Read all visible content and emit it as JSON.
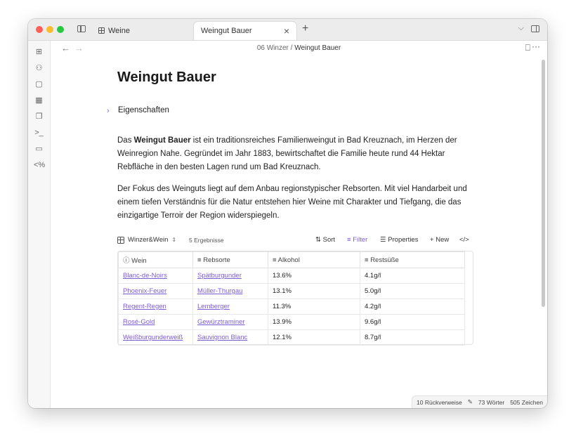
{
  "tabs": [
    {
      "label": "Weine",
      "active": false
    },
    {
      "label": "Weingut Bauer",
      "active": true
    }
  ],
  "breadcrumb": {
    "folder": "06 Winzer",
    "separator": "/",
    "current": "Weingut Bauer"
  },
  "page": {
    "title": "Weingut Bauer",
    "properties_label": "Eigenschaften",
    "para1_pre": "Das ",
    "para1_bold": "Weingut Bauer",
    "para1_post": " ist ein traditionsreiches Familienweingut in Bad Kreuznach, im Herzen der Weinregion Nahe. Gegründet im Jahr 1883, bewirtschaftet die Familie heute rund 44 Hektar Rebfläche in den besten Lagen rund um Bad Kreuznach.",
    "para2": "Der Fokus des Weinguts liegt auf dem Anbau regionstypischer Rebsorten. Mit viel Handarbeit und einem tiefen Verständnis für die Natur entstehen hier Weine mit Charakter und Tiefgang, die das einzigartige Terroir der Region widerspiegeln."
  },
  "bases": {
    "view_name": "Winzer&Wein",
    "results": "5 Ergebnisse",
    "sort_label": "Sort",
    "filter_label": "Filter",
    "properties_label": "Properties",
    "new_label": "New",
    "code_label": "</>",
    "columns": [
      "Wein",
      "Rebsorte",
      "Alkohol",
      "Restsüße"
    ],
    "rows": [
      {
        "wein": "Blanc-de-Noirs",
        "rebsorte": "Spätburgunder",
        "alkohol": "13.6%",
        "restsuesse": "4.1g/l"
      },
      {
        "wein": "Phoenix-Feuer",
        "rebsorte": "Müller-Thurgau",
        "alkohol": "13.1%",
        "restsuesse": "5.0g/l"
      },
      {
        "wein": "Regent-Regen",
        "rebsorte": "Lemberger",
        "alkohol": "11.3%",
        "restsuesse": "4.2g/l"
      },
      {
        "wein": "Rosé-Gold",
        "rebsorte": "Gewürztraminer",
        "alkohol": "13.9%",
        "restsuesse": "9.6g/l"
      },
      {
        "wein": "Weißburgunderweiß",
        "rebsorte": "Sauvignon Blanc",
        "alkohol": "12.1%",
        "restsuesse": "8.7g/l"
      }
    ]
  },
  "status": {
    "backlinks": "10 Rückverweise",
    "words": "73 Wörter",
    "chars": "505 Zeichen"
  },
  "colors": {
    "accent": "#7c5cd6"
  }
}
